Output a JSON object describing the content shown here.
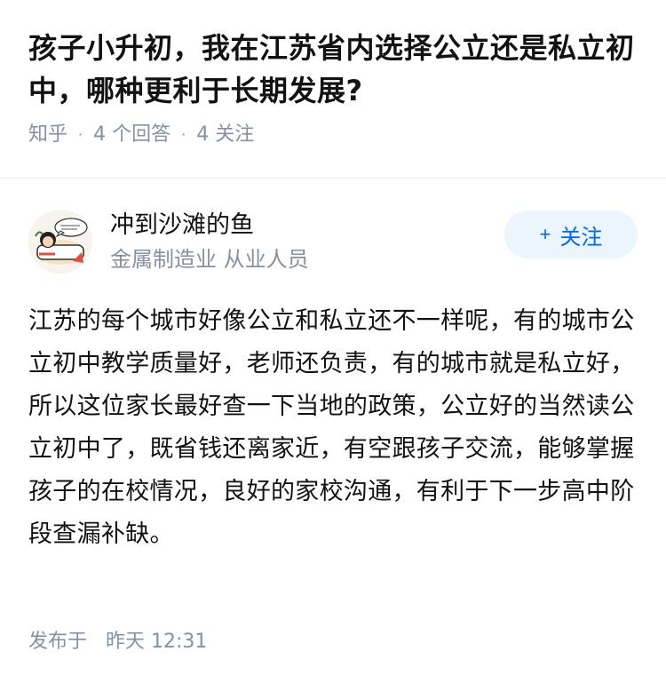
{
  "question": {
    "title": "孩子小升初，我在江苏省内选择公立还是私立初中，哪种更利于长期发展?",
    "source": "知乎",
    "answers_count": "4 个回答",
    "followers_count": "4 关注"
  },
  "answer": {
    "author_name": "冲到沙滩的鱼",
    "author_bio": "金属制造业 从业人员",
    "follow_label": "关注",
    "content": "江苏的每个城市好像公立和私立还不一样呢，有的城市公立初中教学质量好，老师还负责，有的城市就是私立好，所以这位家长最好查一下当地的政策，公立好的当然读公立初中了，既省钱还离家近，有空跟孩子交流，能够掌握孩子的在校情况，良好的家校沟通，有利于下一步高中阶段查漏补缺。",
    "published_label": "发布于",
    "published_time": "昨天 12:31"
  },
  "colors": {
    "accent": "#0066ff",
    "follow_bg": "#ebf5fd",
    "meta_gray": "#8590a6",
    "text": "#121212"
  }
}
